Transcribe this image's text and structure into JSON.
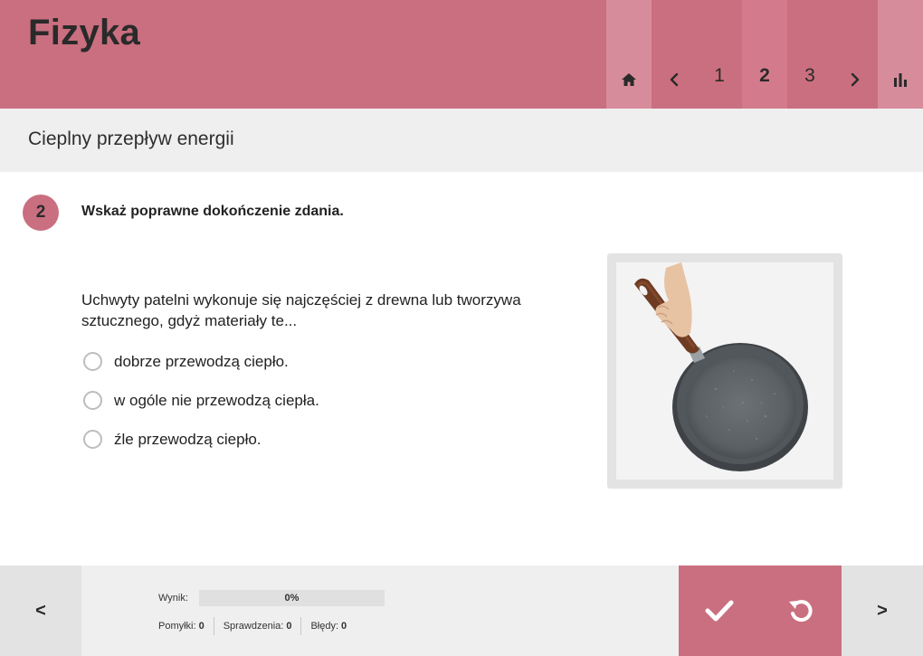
{
  "app": {
    "title": "Fizyka"
  },
  "nav": {
    "pages": [
      "1",
      "2",
      "3"
    ],
    "current_page": "2",
    "icons": {
      "home": "home-icon",
      "prev": "chevron-left-icon",
      "next": "chevron-right-icon",
      "stats": "bar-chart-icon"
    }
  },
  "section": {
    "title": "Cieplny przepływ energii"
  },
  "question": {
    "number": "2",
    "instruction": "Wskaż poprawne dokończenie zdania.",
    "text": "Uchwyty patelni wykonuje się najczęściej z drewna lub tworzywa sztucznego, gdyż materiały te...",
    "options": [
      {
        "label": "dobrze przewodzą ciepło.",
        "selected": false
      },
      {
        "label": "w ogóle nie przewodzą ciepła.",
        "selected": false
      },
      {
        "label": "źle przewodzą ciepło.",
        "selected": false
      }
    ]
  },
  "footer": {
    "prev_label": "<",
    "next_label": ">",
    "score_label": "Wynik:",
    "score_value": "0%",
    "score_fraction": 0,
    "stats": [
      {
        "label": "Pomyłki:",
        "value": "0"
      },
      {
        "label": "Sprawdzenia:",
        "value": "0"
      },
      {
        "label": "Błędy:",
        "value": "0"
      }
    ],
    "icons": {
      "check": "check-icon",
      "reset": "reset-icon"
    }
  },
  "colors": {
    "accent": "#ca6f80",
    "accent_light": "#d78c9b",
    "accent_active": "#d37b8c",
    "panel": "#efefef",
    "panel_dark": "#e3e3e3"
  }
}
